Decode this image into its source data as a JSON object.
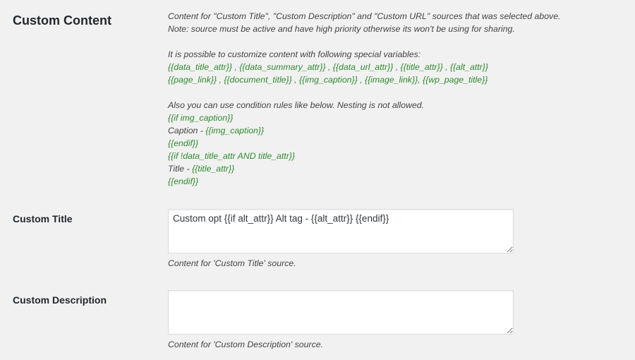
{
  "section": {
    "title": "Custom Content"
  },
  "description": {
    "intro_line1": "Content for \"Custom Title\", \"Custom Description\" and \"Custom URL\" sources that was selected above.",
    "intro_line2": "Note: source must be active and have high priority otherwise its won't be using for sharing.",
    "variables_intro": "It is possible to customize content with following special variables:",
    "variables_line1": "{{data_title_attr}} , {{data_summary_attr}} , {{data_url_attr}} , {{title_attr}} , {{alt_attr}}",
    "variables_line2": "{{page_link}} , {{document_title}} , {{img_caption}} , {{image_link}}, {{wp_page_title}}",
    "conditions_intro": "Also you can use condition rules like below. Nesting is not allowed.",
    "example": {
      "line1": "{{if img_caption}}",
      "line2_text": "Caption - ",
      "line2_var": "{{img_caption}}",
      "line3": "{{endif}}",
      "line4": "{{if !data_title_attr AND title_attr}}",
      "line5_text": "Title - ",
      "line5_var": "{{title_attr}}",
      "line6": "{{endif}}"
    }
  },
  "fields": {
    "custom_title": {
      "label": "Custom Title",
      "value": "Custom opt {{if alt_attr}} Alt tag - {{alt_attr}} {{endif}}",
      "hint": "Content for 'Custom Title' source."
    },
    "custom_description": {
      "label": "Custom Description",
      "value": "",
      "hint": "Content for 'Custom Description' source."
    }
  },
  "colors": {
    "variable": "#2e8b2e",
    "background": "#f1f1f1"
  }
}
